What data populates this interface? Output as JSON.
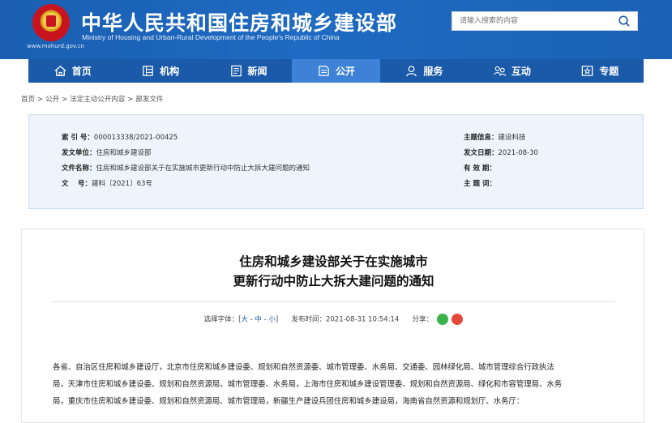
{
  "header": {
    "title_cn": "中华人民共和国住房和城乡建设部",
    "title_en": "Ministry of Housing and Urban-Rural Development of the People's Republic of China",
    "url": "www.mohurd.gov.cn",
    "search_placeholder": "请输入搜索的内容"
  },
  "nav": {
    "items": [
      {
        "label": "首页",
        "icon": "home-icon"
      },
      {
        "label": "机构",
        "icon": "building-icon"
      },
      {
        "label": "新闻",
        "icon": "news-icon"
      },
      {
        "label": "公开",
        "icon": "document-icon"
      },
      {
        "label": "服务",
        "icon": "service-icon"
      },
      {
        "label": "互动",
        "icon": "interaction-icon"
      },
      {
        "label": "专题",
        "icon": "topic-icon"
      }
    ],
    "active_index": 3
  },
  "breadcrumb": [
    "首页",
    "公开",
    "法定主动公开内容",
    "部发文件"
  ],
  "meta": {
    "index_label": "索 引 号：",
    "index_value": "000013338/2021-00425",
    "issuer_label": "发文单位：",
    "issuer_value": "住房和城乡建设部",
    "docname_label": "文件名称：",
    "docname_value": "住房和城乡建设部关于在实施城市更新行动中防止大拆大建问题的通知",
    "docno_label": "文　 号：",
    "docno_value": "建科〔2021〕63号",
    "topic_label": "主题信息：",
    "topic_value": "建设科技",
    "date_label": "发文日期：",
    "date_value": "2021-08-30",
    "validity_label": "有 效 期：",
    "validity_value": "",
    "keywords_label": "主 题 词：",
    "keywords_value": ""
  },
  "article": {
    "title_line1": "住房和城乡建设部关于在实施城市",
    "title_line2": "更新行动中防止大拆大建问题的通知",
    "font_label": "选择字体：[",
    "font_large": "大",
    "font_medium": "中",
    "font_small": "小",
    "font_close": "]",
    "time_label": "发布时间：",
    "time_value": "2021-08-31 10:54:14",
    "share_label": "分享：",
    "body_line1": "各省、自治区住房和城乡建设厅，北京市住房和城乡建设委、规划和自然资源委、城市管理委、水务局、交通委、园林绿化局、城市管理综合行政执法",
    "body_line2": "局，天津市住房和城乡建设委、规划和自然资源局、城市管理委、水务局，上海市住房和城乡建设管理委、规划和自然资源局、绿化和市容管理局、水务",
    "body_line3": "局，重庆市住房和城乡建设委、规划和自然资源局、城市管理局，新疆生产建设兵团住房和城乡建设局，海南省自然资源和规划厅、水务厅："
  },
  "colors": {
    "header_blue": "#1c64b8",
    "nav_blue": "#1b5aa8",
    "nav_active": "#3d82d6",
    "meta_bg": "#eef4fb"
  }
}
